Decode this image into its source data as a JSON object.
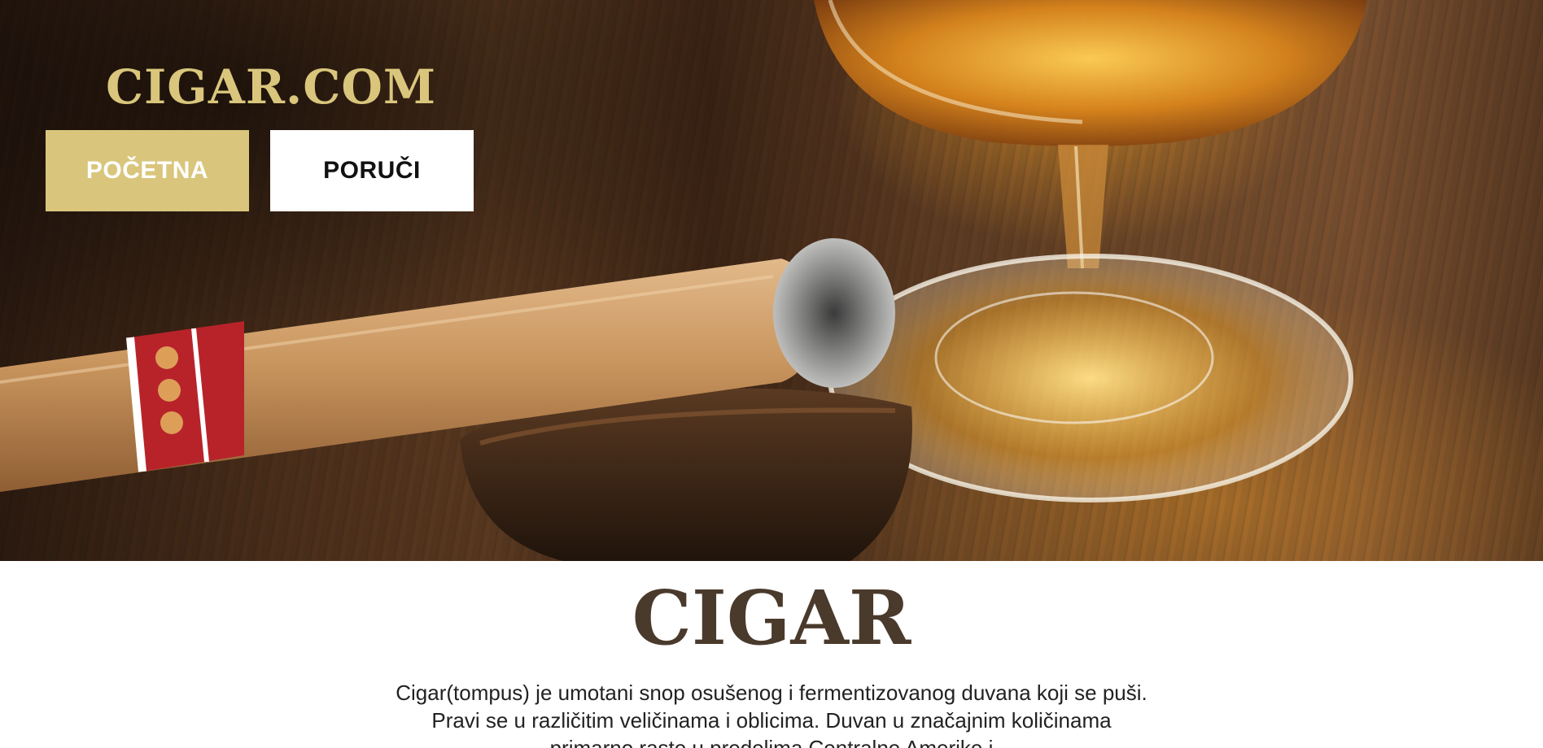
{
  "site": {
    "logo": "CIGAR.COM"
  },
  "nav": {
    "items": [
      {
        "label": "POČETNA",
        "active": true
      },
      {
        "label": "PORUČI",
        "active": false
      }
    ]
  },
  "hero": {
    "image": "cigar-and-cognac-photo"
  },
  "main": {
    "title": "CIGAR",
    "intro": "Cigar(tompus) je umotani snop osušenog i fermentizovanog duvana koji se puši. Pravi se u različitim veličinama i oblicima. Duvan u značajnim količinama primarno raste u predelima Centralne Amerike i"
  },
  "colors": {
    "accent": "#d9c67c",
    "title": "#4a3a2c"
  }
}
